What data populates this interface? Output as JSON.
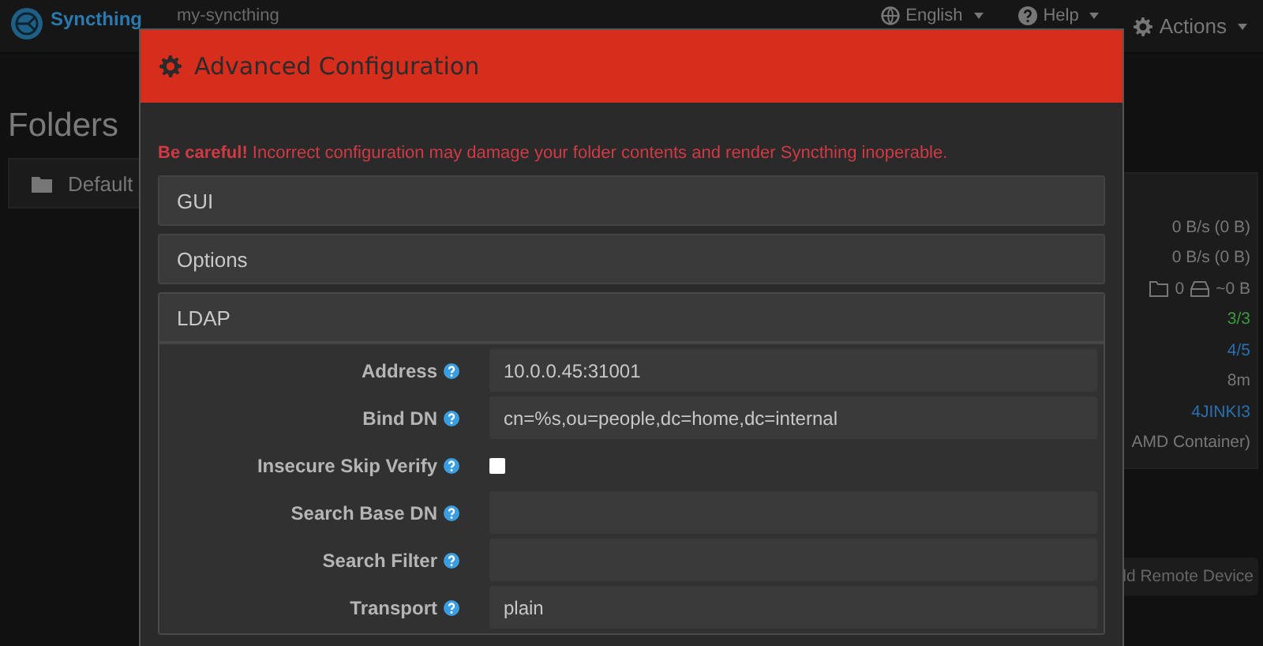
{
  "navbar": {
    "brand": "Syncthing",
    "device_name": "my-syncthing",
    "menus": [
      {
        "kind": "language",
        "label": "English"
      },
      {
        "kind": "help",
        "label": "Help"
      },
      {
        "kind": "actions",
        "label": "Actions"
      }
    ]
  },
  "folders": {
    "heading": "Folders",
    "items": [
      {
        "name": "Default"
      }
    ]
  },
  "device_panel": {
    "rows": [
      {
        "kind": "text",
        "value": "0 B/s (0 B)"
      },
      {
        "kind": "text",
        "value": "0 B/s (0 B)"
      },
      {
        "kind": "counts",
        "folders": "0",
        "size": "~0 B"
      },
      {
        "kind": "text",
        "value": "3/3",
        "color": "#3b9a3b"
      },
      {
        "kind": "text",
        "value": "4/5",
        "color": "#2a6fb0"
      },
      {
        "kind": "text",
        "value": "8m"
      },
      {
        "kind": "text",
        "value": "4JINKI3",
        "color": "#2a6fb0"
      },
      {
        "kind": "text",
        "value": "AMD Container)"
      }
    ],
    "add_button": "ld Remote Device"
  },
  "modal": {
    "title": "Advanced Configuration",
    "warning": "**Be careful!** Incorrect configuration may damage your folder contents and render Syncthing inoperable.",
    "sections": [
      {
        "title": "GUI",
        "expanded": false
      },
      {
        "title": "Options",
        "expanded": false
      },
      {
        "title": "LDAP",
        "expanded": true,
        "fields": [
          {
            "label": "Address",
            "kind": "text",
            "value": "10.0.0.45:31001"
          },
          {
            "label": "Bind DN",
            "kind": "text",
            "value": "cn=%s,ou=people,dc=home,dc=internal"
          },
          {
            "label": "Insecure Skip Verify",
            "kind": "checkbox",
            "checked": false
          },
          {
            "label": "Search Base DN",
            "kind": "text"
          },
          {
            "label": "Search Filter",
            "kind": "text"
          },
          {
            "label": "Transport",
            "kind": "text",
            "value": "plain"
          }
        ]
      }
    ]
  }
}
